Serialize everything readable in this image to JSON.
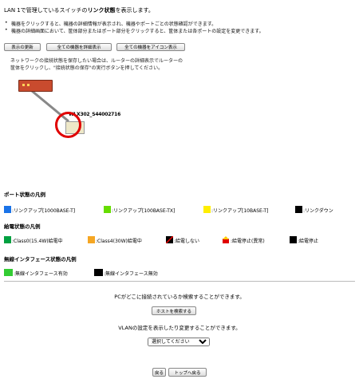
{
  "header": {
    "title_pre": "LAN 1で管理しているスイッチの",
    "title_bold": "リンク状態",
    "title_post": "を表示します。"
  },
  "bullets": [
    "機器をクリックすると、機器の詳細情報が表示され、機器やポートごとの状態確認ができます。",
    "機器の詳細画面において、筐体部分またはポート部分をクリックすると、筐体または各ポートの設定を変更できます。"
  ],
  "toolbar": {
    "refresh": "表示の更新",
    "show_detail": "全ての機器を詳細表示",
    "show_icon": "全ての機器をアイコン表示"
  },
  "note": [
    "ネットワークの接続状態を保存したい場合は、ルーターの詳細表示でルーターの",
    "筐体をクリックし、\"接続状態の保存\"の実行ボタンを押してください。"
  ],
  "device": {
    "label": "WLX302_S44002716"
  },
  "port_legend": {
    "heading": "ポート状態の凡例",
    "items": [
      {
        "label": ":リンクアップ[1000BASE-T]",
        "color": "#1a73e8"
      },
      {
        "label": ":リンクアップ[100BASE-TX]",
        "color": "#66dd00"
      },
      {
        "label": ":リンクアップ[10BASE-T]",
        "color": "#ffee00"
      },
      {
        "label": ":リンクダウン",
        "color": "#000000"
      }
    ]
  },
  "power_legend": {
    "heading": "給電状態の凡例",
    "items": [
      {
        "label": ":Class0(15.4W)給電中",
        "color": "#00a040"
      },
      {
        "label": ":Class4(30W)給電中",
        "color": "#f5a623"
      },
      {
        "label": ":給電しない",
        "color": "#000000"
      },
      {
        "label": ":給電停止(異常)",
        "color": "#e00000"
      },
      {
        "label": ":給電停止",
        "color": "#000000"
      }
    ]
  },
  "wireless_legend": {
    "heading": "無線インタフェース状態の凡例",
    "items": [
      {
        "label": ":無線インタフェース有効",
        "color": "#33cc33"
      },
      {
        "label": ":無線インタフェース無効",
        "color": "#000000"
      }
    ]
  },
  "search": {
    "text": "PCがどこに接続されているか検索することができます。",
    "button": "ホストを検索する"
  },
  "vlan": {
    "text": "VLANの設定を表示したり変更することができます。",
    "selected": "選択してください"
  },
  "footer": {
    "back": "戻る",
    "top": "トップへ戻る"
  }
}
